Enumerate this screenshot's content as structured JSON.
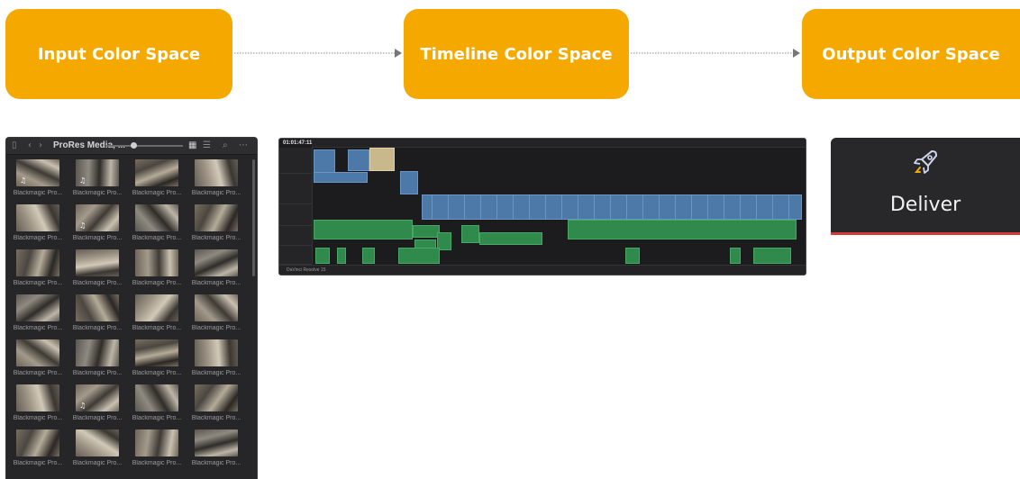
{
  "flow": {
    "step1": "Input Color Space",
    "step2": "Timeline Color Space",
    "step3": "Output Color Space"
  },
  "media_pool": {
    "title": "ProRes Media, ...",
    "clip_label": "Blackmagic Pro...",
    "rows": 7,
    "columns": 4,
    "audio_icon": "music-note-icon"
  },
  "timeline": {
    "timecode": "01:01:47:11",
    "app_name": "DaVinci Resolve 15"
  },
  "deliver": {
    "label": "Deliver",
    "icon": "rocket-icon"
  },
  "colors": {
    "flow_box": "#f5a800",
    "panel_bg": "#262628",
    "video_clip": "#4c79a8",
    "audio_clip": "#2f8a4c",
    "deliver_accent": "#d33a3a"
  }
}
